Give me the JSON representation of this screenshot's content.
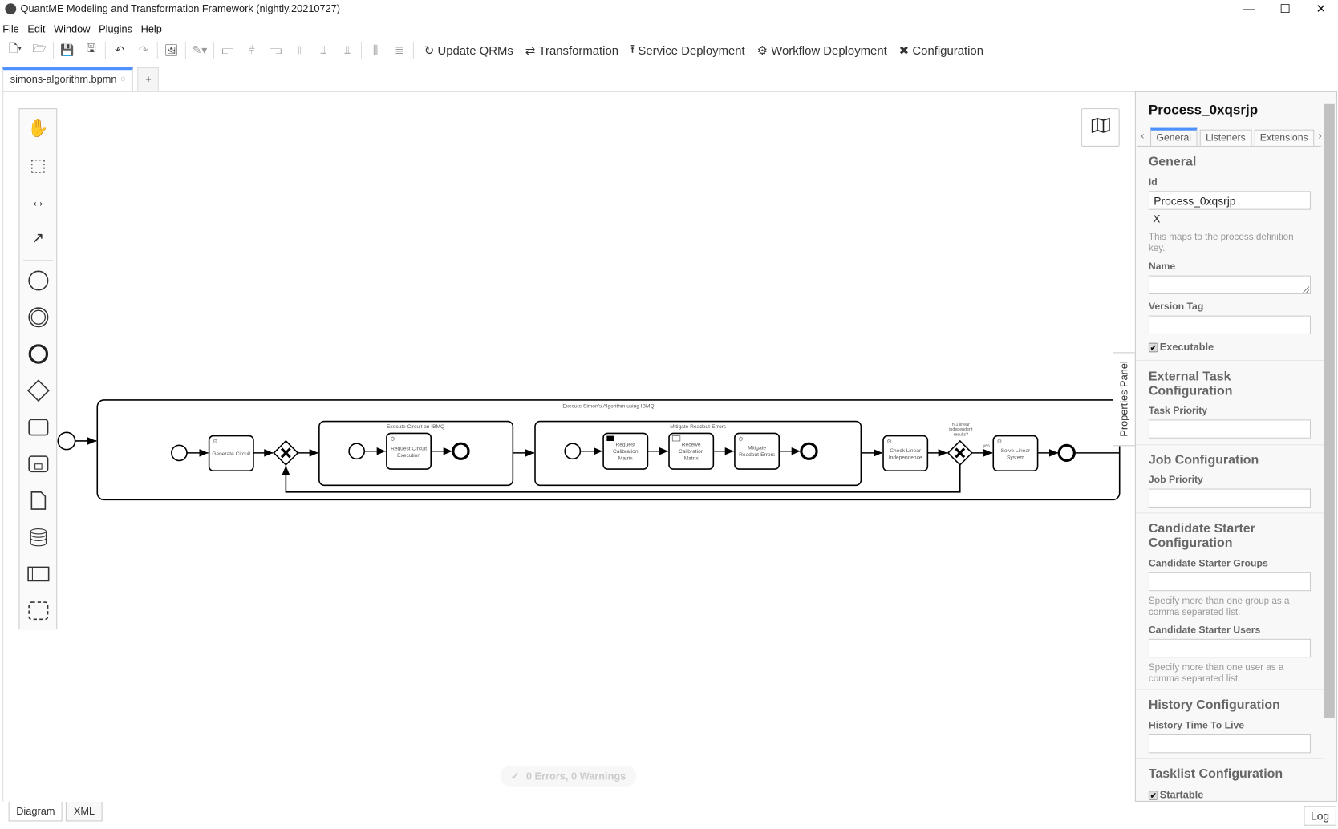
{
  "window": {
    "title": "QuantME Modeling and Transformation Framework (nightly.20210727)",
    "minimize": "—",
    "maximize": "☐",
    "close": "✕"
  },
  "menu": [
    "File",
    "Edit",
    "Window",
    "Plugins",
    "Help"
  ],
  "toolbar": {
    "update_qrms": "Update QRMs",
    "transformation": "Transformation",
    "service_deployment": "Service Deployment",
    "workflow_deployment": "Workflow Deployment",
    "configuration": "Configuration"
  },
  "tabs": {
    "file": "simons-algorithm.bpmn",
    "add": "+"
  },
  "diagram": {
    "main_subprocess": "Execute Simon's Algorithm using IBMQ",
    "tasks": {
      "generate_circuit": [
        "Generate Circuit"
      ],
      "request_execution": [
        "Request Circuit",
        "Execution"
      ],
      "request_calibration": [
        "Request",
        "Calibration",
        "Matrix"
      ],
      "receive_calibration": [
        "Receive",
        "Calibration",
        "Matrix"
      ],
      "mitigate": [
        "Mitigate",
        "Readout-Errors"
      ],
      "check_linear": [
        "Check Linear",
        "Independence"
      ],
      "solve_linear": [
        "Solve Linear",
        "System"
      ]
    },
    "sub_execute": "Execute Circuit on IBMQ",
    "sub_mitigate": "Mitigate Readout-Errors",
    "gateway_label": [
      "n-1 linear",
      "independent",
      "results?"
    ],
    "yes_label": "yes"
  },
  "properties_toggle": "Properties Panel",
  "panel": {
    "title": "Process_0xqsrjp",
    "tabs": [
      "General",
      "Listeners",
      "Extensions"
    ],
    "general": {
      "heading": "General",
      "id_label": "Id",
      "id_value": "Process_0xqsrjp",
      "clear": "X",
      "id_hint": "This maps to the process definition key.",
      "name_label": "Name",
      "name_value": "",
      "version_label": "Version Tag",
      "version_value": "",
      "executable": "Executable"
    },
    "external": {
      "heading": "External Task Configuration",
      "label": "Task Priority"
    },
    "job": {
      "heading": "Job Configuration",
      "label": "Job Priority"
    },
    "candidate": {
      "heading": "Candidate Starter Configuration",
      "groups_label": "Candidate Starter Groups",
      "groups_hint": "Specify more than one group as a comma separated list.",
      "users_label": "Candidate Starter Users",
      "users_hint": "Specify more than one user as a comma separated list."
    },
    "history": {
      "heading": "History Configuration",
      "label": "History Time To Live"
    },
    "tasklist": {
      "heading": "Tasklist Configuration",
      "startable": "Startable"
    }
  },
  "status": {
    "errors": "0 Errors, 0 Warnings"
  },
  "bottom": {
    "diagram": "Diagram",
    "xml": "XML",
    "log": "Log"
  },
  "colors": {
    "accent": "#4d90fe"
  }
}
